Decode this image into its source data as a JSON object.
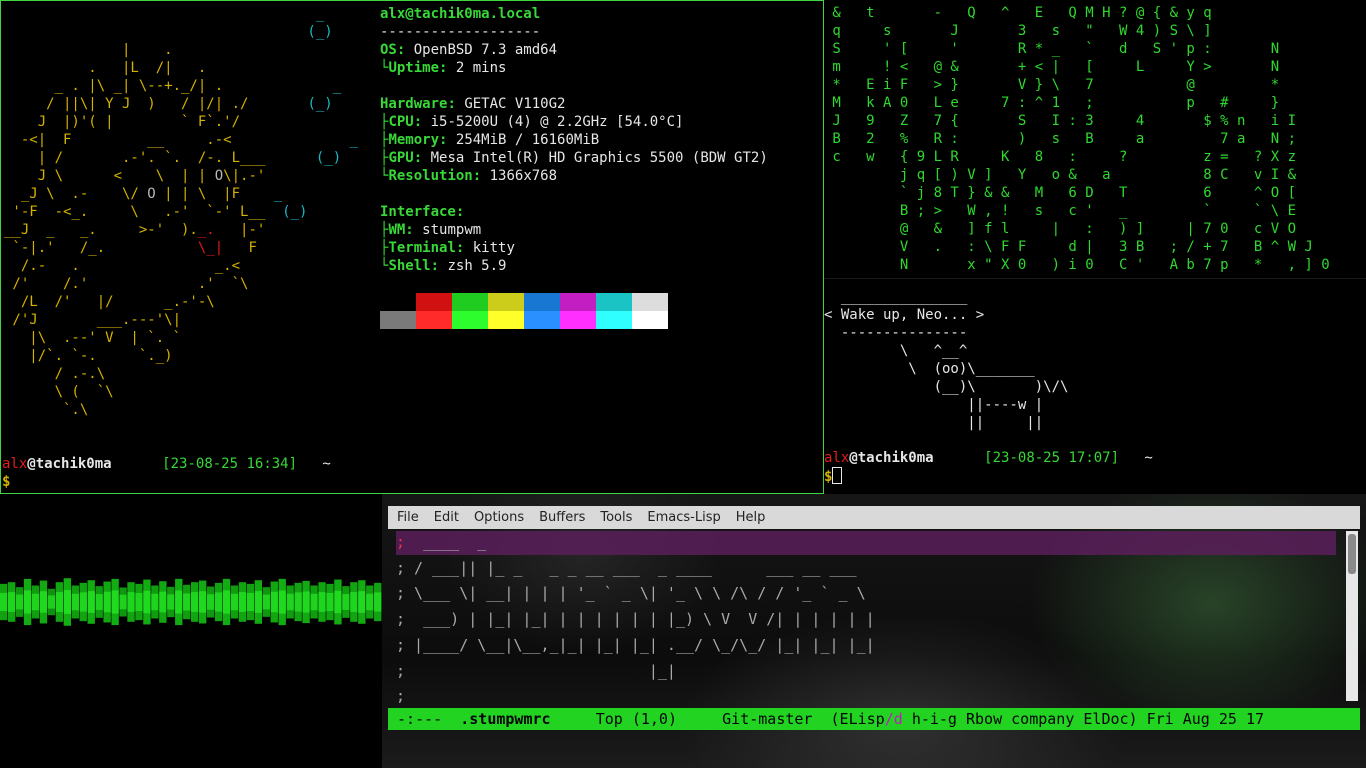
{
  "fetch_pane": {
    "ascii_lines": [
      [
        {
          "t": "                                     _",
          "c": "c"
        }
      ],
      [
        {
          "t": "                                    (_)",
          "c": "c"
        }
      ],
      [
        {
          "t": "              |    .",
          "c": "y"
        }
      ],
      [
        {
          "t": "          .   |L  /|   .",
          "c": "y"
        }
      ],
      [
        {
          "t": "      _ . |\\ _| \\--+._/| .",
          "c": "y"
        },
        {
          "t": "             _",
          "c": "c"
        }
      ],
      [
        {
          "t": "     / ||\\| Y J  )   / |/| ./",
          "c": "y"
        },
        {
          "t": "       (_)",
          "c": "c"
        }
      ],
      [
        {
          "t": "    J  |)'( |        ` F`.'/",
          "c": "y"
        }
      ],
      [
        {
          "t": "  -<|  F         __     .-<",
          "c": "y"
        },
        {
          "t": "              _",
          "c": "c"
        }
      ],
      [
        {
          "t": "    | /       .-'. `.  /-. L___",
          "c": "y"
        },
        {
          "t": "      (_)",
          "c": "c"
        }
      ],
      [
        {
          "t": "    J \\      <    \\  | | ",
          "c": "y"
        },
        {
          "t": "O",
          "c": "g"
        },
        {
          "t": "\\|.-'",
          "c": "y"
        }
      ],
      [
        {
          "t": "  _J \\  .-    \\/ ",
          "c": "y"
        },
        {
          "t": "O",
          "c": "g"
        },
        {
          "t": " | | \\  |F",
          "c": "y"
        },
        {
          "t": "    _",
          "c": "c"
        }
      ],
      [
        {
          "t": " '-F  -<_.     \\   .-'  `-' L__",
          "c": "y"
        },
        {
          "t": "  (_)",
          "c": "c"
        }
      ],
      [
        {
          "t": "__J  _   _.     >-'  ).",
          "c": "y"
        },
        {
          "t": "_.",
          "c": "r"
        },
        {
          "t": "   |-'",
          "c": "y"
        }
      ],
      [
        {
          "t": " `-|.'   /_.           ",
          "c": "y"
        },
        {
          "t": "\\_|",
          "c": "r"
        },
        {
          "t": "   F",
          "c": "y"
        }
      ],
      [
        {
          "t": "  /.-   .                _.<",
          "c": "y"
        }
      ],
      [
        {
          "t": " /'    /.'             .'  `\\",
          "c": "y"
        }
      ],
      [
        {
          "t": "  /L  /'   |/      _.-'-\\",
          "c": "y"
        }
      ],
      [
        {
          "t": " /'J       ___.---'\\|",
          "c": "y"
        }
      ],
      [
        {
          "t": "   |\\  .--' V  | `. `",
          "c": "y"
        }
      ],
      [
        {
          "t": "   |/`. `-.     `._)",
          "c": "y"
        }
      ],
      [
        {
          "t": "      / .-.\\",
          "c": "y"
        }
      ],
      [
        {
          "t": "      \\ (  `\\",
          "c": "y"
        }
      ],
      [
        {
          "t": "       `.\\",
          "c": "y"
        }
      ]
    ],
    "title_user": "alx",
    "title_host": "tachik0ma.local",
    "separator": "-------------------",
    "os_label": "OS",
    "os_value": "OpenBSD 7.3 amd64",
    "uptime_label": "Uptime",
    "uptime_value": "2 mins",
    "hardware_label": "Hardware",
    "hardware_value": "GETAC V110G2",
    "cpu_label": "CPU",
    "cpu_value": "i5-5200U (4) @ 2.2GHz [54.0°C]",
    "memory_label": "Memory",
    "memory_value": "254MiB / 16160MiB",
    "gpu_label": "GPU",
    "gpu_value": "Mesa Intel(R) HD Graphics 5500 (BDW GT2)",
    "resolution_label": "Resolution",
    "resolution_value": "1366x768",
    "interface_label": "Interface",
    "wm_label": "WM",
    "wm_value": "stumpwm",
    "terminal_label": "Terminal",
    "terminal_value": "kitty",
    "shell_label": "Shell",
    "shell_value": "zsh 5.9",
    "palette_top": [
      "#000000",
      "#d11111",
      "#1fcc1f",
      "#cccc1a",
      "#1877d2",
      "#c21ec2",
      "#1ac4c4",
      "#dddddd"
    ],
    "palette_bottom": [
      "#7a7a7a",
      "#ff2a2a",
      "#2dfc2d",
      "#ffff2a",
      "#2a90ff",
      "#ff30ff",
      "#30ffff",
      "#ffffff"
    ],
    "prompt": {
      "user": "alx",
      "at": "@",
      "host": "tachik0ma",
      "time": "[23-08-25 16:34]",
      "dir": "~",
      "symbol": "$"
    }
  },
  "matrix_pane": {
    "lines": [
      " &   t       -   Q   ^   E   Q M H ? @ { & y q",
      " q     s       J       3   s   \"   W 4 ) S \\ ]",
      " S     ' [     '       R * _   `   d   S ' p :       N",
      " m     ! <   @ &       + < |   [     L     Y >       N",
      " *   E i F   > }       V } \\   7           @         *",
      " M   k A 0   L e     7 : ^ 1   ;           p   #     }",
      " J   9   Z   7 {       S   I : 3     4       $ % n   i I",
      " B   2   %   R :       )   s   B     a         7 a   N ;",
      " c   w   { 9 L R     K   8   :     ?         z =   ? X z",
      "         j q [ ) V ]   Y   o &   a           8 C   v I &",
      "         ` j 8 T } & &   M   6 D   T         6     ^ O [",
      "         B ; >   W , !   s   c '   _         `     ` \\ E",
      "         @   &   ] f l     |   :   ) ]     | 7 0   c V O",
      "         V   .   : \\ F F     d |   3 B   ; / + 7   B ^ W J",
      "         N       x \" X 0   ) i 0   C '   A b 7 p   *   , ] 0"
    ]
  },
  "cowsay_pane": {
    "bubble_top": "  _______________",
    "message": "< Wake up, Neo... >",
    "bubble_bottom": "  ---------------",
    "cow_lines": [
      "         \\   ^__^",
      "          \\  (oo)\\_______",
      "             (__)\\       )\\/\\",
      "                 ||----w |",
      "                 ||     ||"
    ],
    "prompt": {
      "user": "alx",
      "at": "@",
      "host": "tachik0ma",
      "time": "[23-08-25 17:07]",
      "dir": "~",
      "symbol": "$"
    }
  },
  "visualizer": {
    "bar_color": "#15c915",
    "levels": [
      0.55,
      0.6,
      0.45,
      0.7,
      0.5,
      0.65,
      0.4,
      0.6,
      0.72,
      0.5,
      0.58,
      0.66,
      0.48,
      0.62,
      0.7,
      0.44,
      0.6,
      0.55,
      0.68,
      0.5,
      0.63,
      0.46,
      0.7,
      0.52,
      0.6,
      0.65,
      0.47,
      0.58,
      0.7,
      0.5,
      0.6,
      0.55,
      0.66,
      0.45,
      0.62,
      0.7,
      0.5,
      0.58,
      0.64,
      0.5,
      0.6,
      0.55,
      0.68,
      0.48,
      0.6,
      0.66,
      0.5,
      0.58
    ]
  },
  "emacs": {
    "menu": [
      "File",
      "Edit",
      "Options",
      "Buffers",
      "Tools",
      "Emacs-Lisp",
      "Help"
    ],
    "code_lines": [
      ";  ____  _",
      "; / ___|| |_ _   _ _ __ ___  _ ____      ___ __ ___",
      "; \\___ \\| __| | | | '_ ` _ \\| '_ \\ \\ /\\ / / '_ ` _ \\",
      ";  ___) | |_| |_| | | | | | | |_) \\ V  V /| | | | | |",
      "; |____/ \\__|\\__,_|_| |_| |_| .__/ \\_/\\_/ |_| |_| |_|",
      ";                           |_|",
      ";"
    ],
    "modeline": {
      "state": "-:---",
      "buffer": ".stumpwmrc",
      "position": "Top (1,0)",
      "vc": "Git-master",
      "modes_open": "(ELisp",
      "modes_sep": "/d",
      "modes_rest": "h-i-g Rbow company ElDoc)",
      "datetime": "Fri Aug 25 17"
    }
  }
}
